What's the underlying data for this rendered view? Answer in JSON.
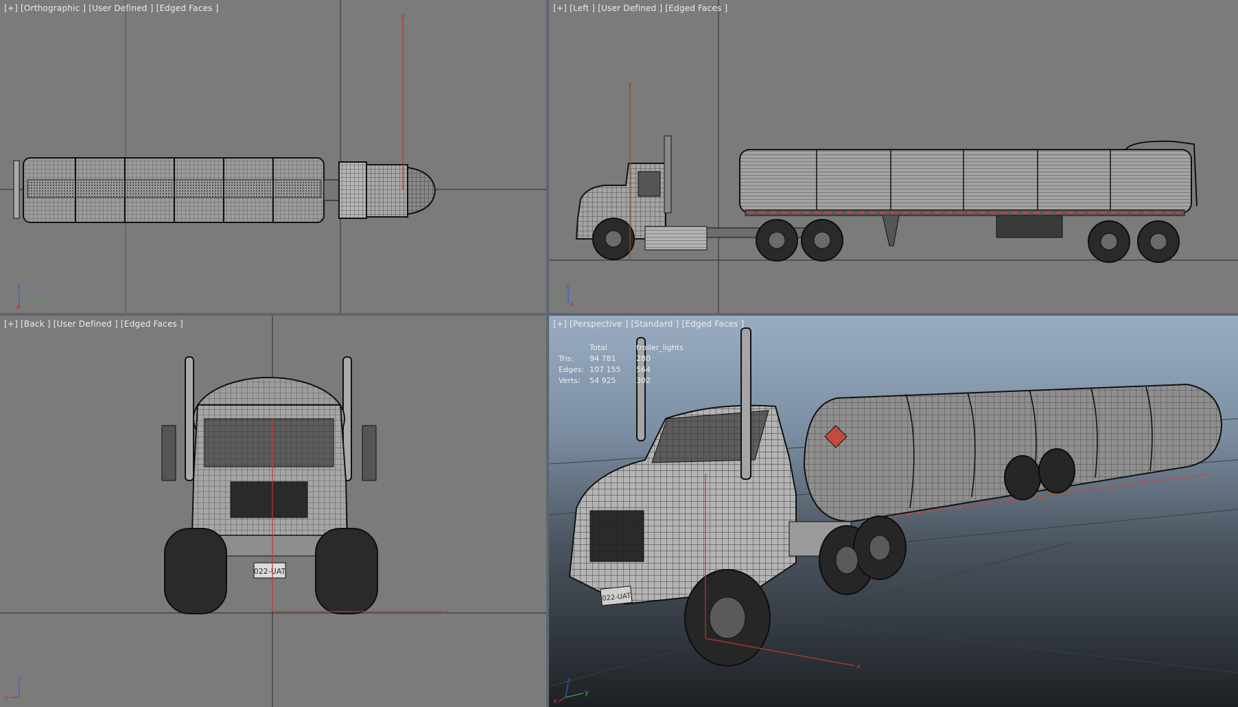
{
  "viewports": {
    "top": {
      "label": "[+] [Orthographic ] [User Defined ] [Edged Faces ]"
    },
    "left": {
      "label": "[+] [Left ] [User Defined ] [Edged Faces ]"
    },
    "back": {
      "label": "[+] [Back ] [User Defined ] [Edged Faces ]"
    },
    "perspective": {
      "label": "[+] [Perspective ] [Standard ] [Edged Faces ]"
    }
  },
  "stats": {
    "headers": [
      "",
      "Total",
      "trailer_lights"
    ],
    "rows": [
      {
        "label": "Tris:",
        "total": "94 781",
        "selected": "280"
      },
      {
        "label": "Edges:",
        "total": "107 155",
        "selected": "564"
      },
      {
        "label": "Verts:",
        "total": "54 925",
        "selected": "302"
      }
    ]
  },
  "axes": {
    "x": "x",
    "y": "y",
    "z": "z"
  },
  "model": {
    "plate_text": "022-UAT"
  },
  "colors": {
    "viewport_bg": "#7b7b7b",
    "border": "#5d6670",
    "axis_red": "#c0392b",
    "axis_green": "#3fa63f",
    "axis_blue": "#3b5bd6",
    "wire": "#1c1c1c"
  }
}
